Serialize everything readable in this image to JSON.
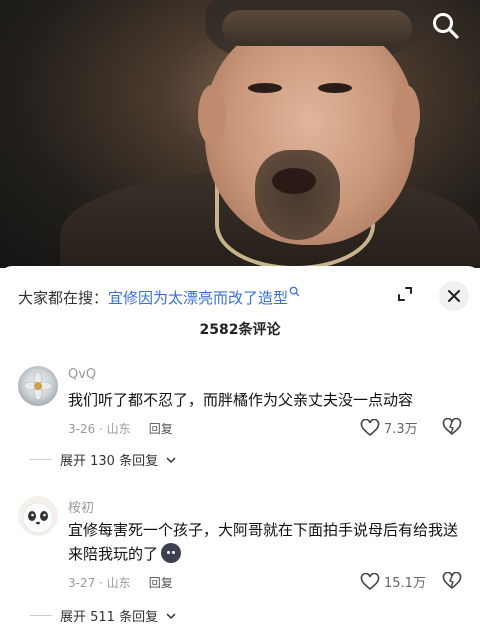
{
  "search_bar": {
    "prefix": "大家都在搜：",
    "keyword": "宜修因为太漂亮而改了造型"
  },
  "comment_count": "2582条评论",
  "comments": [
    {
      "username": "QvQ",
      "text": "我们听了都不忍了，而胖橘作为父亲丈夫没一点动容",
      "date": "3-26 · 山东",
      "reply_label": "回复",
      "likes": "7.3万",
      "replies_label": "展开 130 条回复",
      "avatar_icon": "flower-avatar"
    },
    {
      "username": "桉初",
      "text": "宜修每害死一个孩子，大阿哥就在下面拍手说母后有给我送来陪我玩的了",
      "emoji": "dark-face-emoji",
      "date": "3-27 · 山东",
      "reply_label": "回复",
      "likes": "15.1万",
      "replies_label": "展开 511 条回复",
      "avatar_icon": "panda-avatar"
    }
  ],
  "colors": {
    "keyword": "#3a6fd8",
    "meta": "#9a9a9a"
  }
}
